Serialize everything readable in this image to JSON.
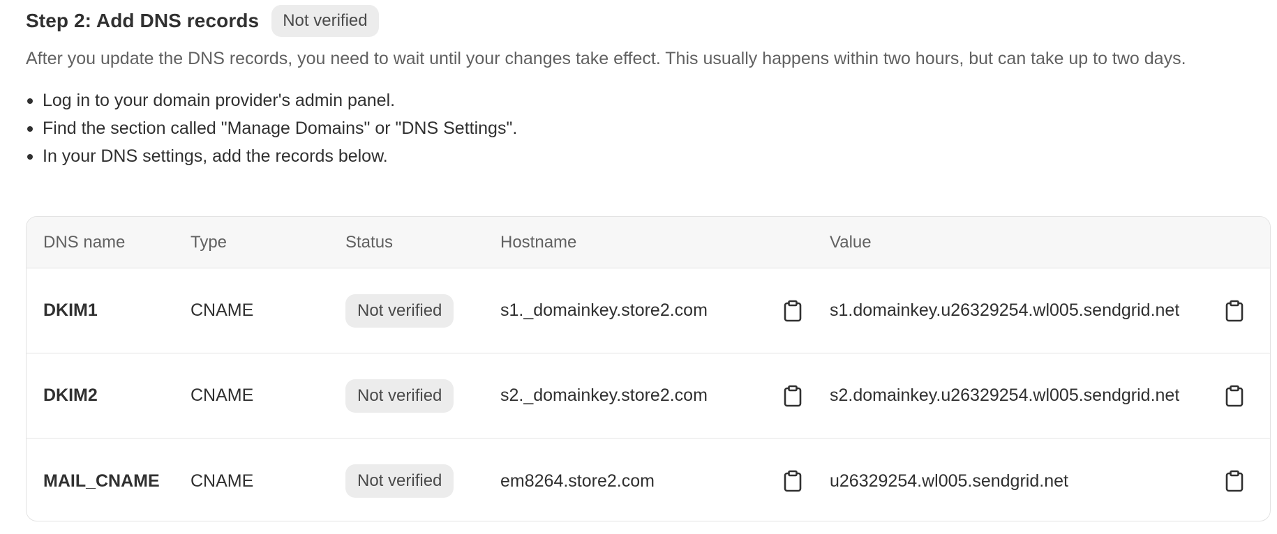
{
  "header": {
    "title": "Step 2: Add DNS records",
    "status_badge": "Not verified"
  },
  "description": "After you update the DNS records, you need to wait until your changes take effect. This usually happens within two hours, but can take up to two days.",
  "steps": [
    "Log in to your domain provider's admin panel.",
    "Find the section called \"Manage Domains\" or \"DNS Settings\".",
    "In your DNS settings, add the records below."
  ],
  "table": {
    "columns": {
      "name": "DNS name",
      "type": "Type",
      "status": "Status",
      "hostname": "Hostname",
      "value": "Value"
    },
    "rows": [
      {
        "name": "DKIM1",
        "type": "CNAME",
        "status": "Not verified",
        "hostname": "s1._domainkey.store2.com",
        "value": "s1.domainkey.u26329254.wl005.sendgrid.net"
      },
      {
        "name": "DKIM2",
        "type": "CNAME",
        "status": "Not verified",
        "hostname": "s2._domainkey.store2.com",
        "value": "s2.domainkey.u26329254.wl005.sendgrid.net"
      },
      {
        "name": "MAIL_CNAME",
        "type": "CNAME",
        "status": "Not verified",
        "hostname": "em8264.store2.com",
        "value": "u26329254.wl005.sendgrid.net"
      }
    ]
  },
  "icons": {
    "copy": "clipboard-icon"
  }
}
